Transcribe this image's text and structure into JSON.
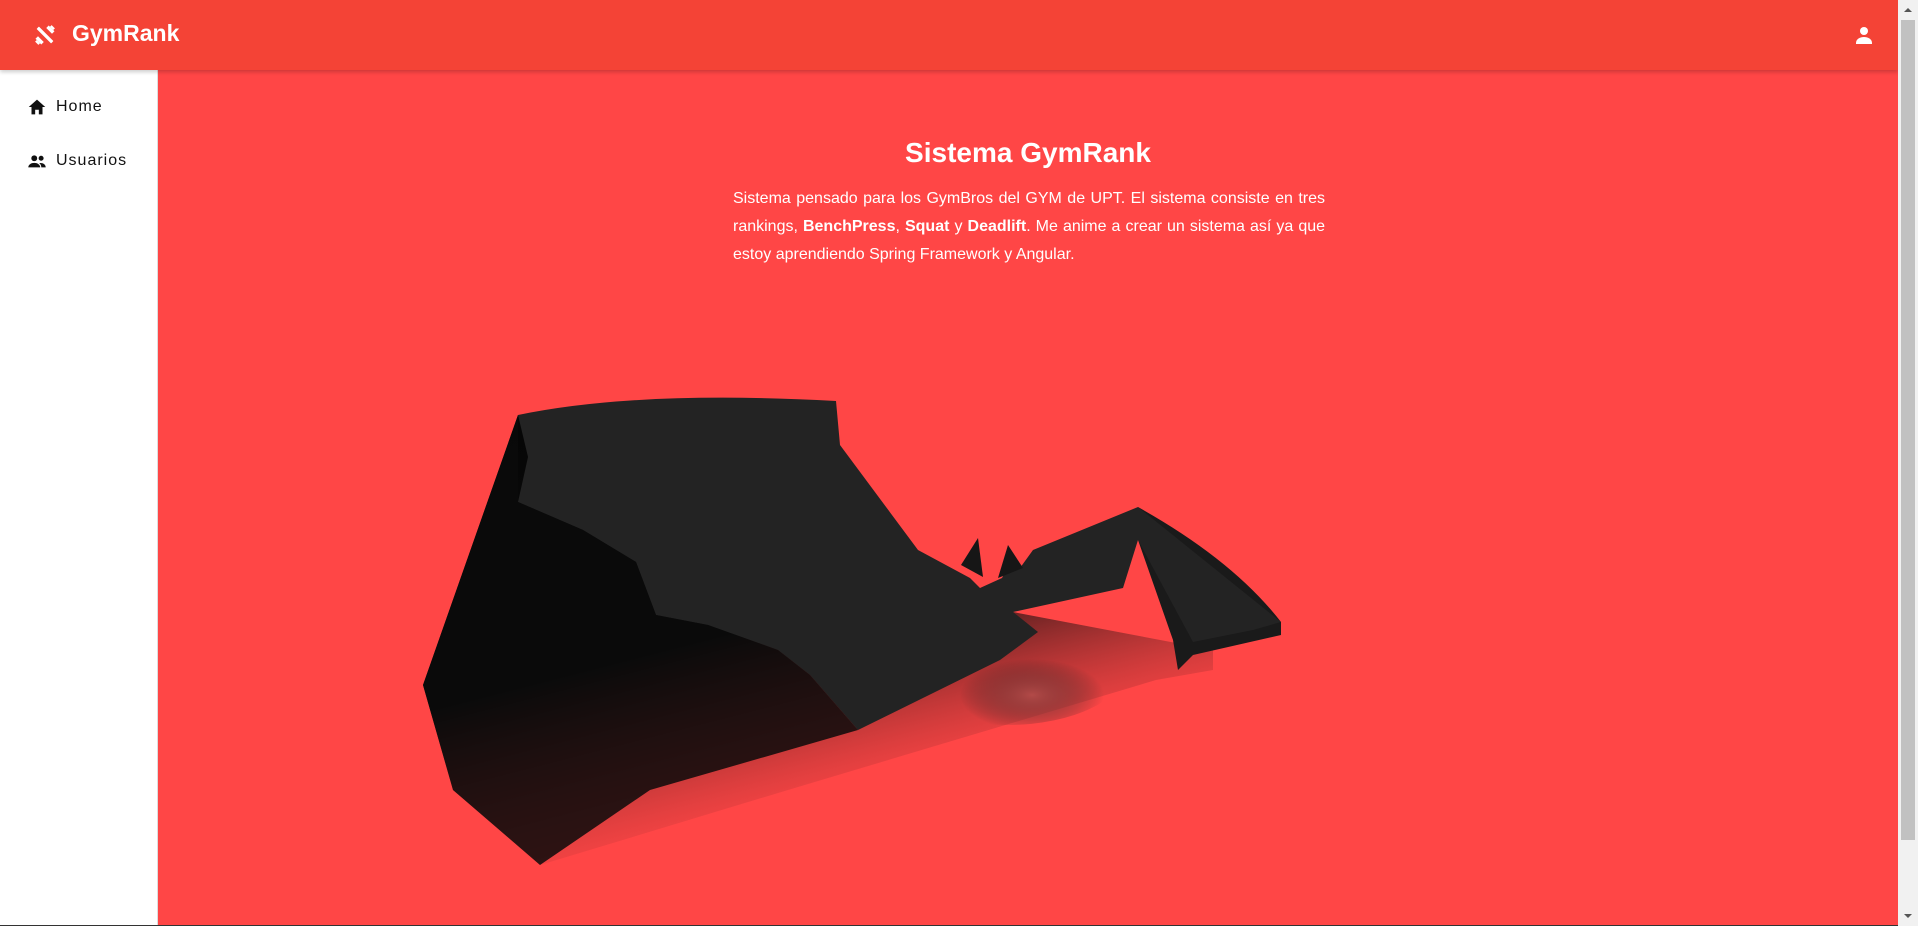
{
  "app": {
    "title": "GymRank",
    "brand_icon": "fitness-dumbbell-icon",
    "account_icon": "person-icon"
  },
  "sidebar": {
    "items": [
      {
        "label": "Home",
        "icon": "home-icon"
      },
      {
        "label": "Usuarios",
        "icon": "group-icon"
      }
    ]
  },
  "main": {
    "title": "Sistema GymRank",
    "intro_before": "Sistema pensado para los GymBros del GYM de UPT. El sistema consiste en tres rankings, ",
    "bench": "BenchPress",
    "sep1": ", ",
    "squat": "Squat",
    "sep2": " y ",
    "deadlift": "Deadlift",
    "intro_after": ". Me anime a crear un sistema así ya que estoy aprendiendo Spring Framework y Angular.",
    "illustration": "bat-silhouette-illustration"
  },
  "colors": {
    "toolbar": "#f44336",
    "background": "#ff4646",
    "sidebar": "#ffffff"
  }
}
